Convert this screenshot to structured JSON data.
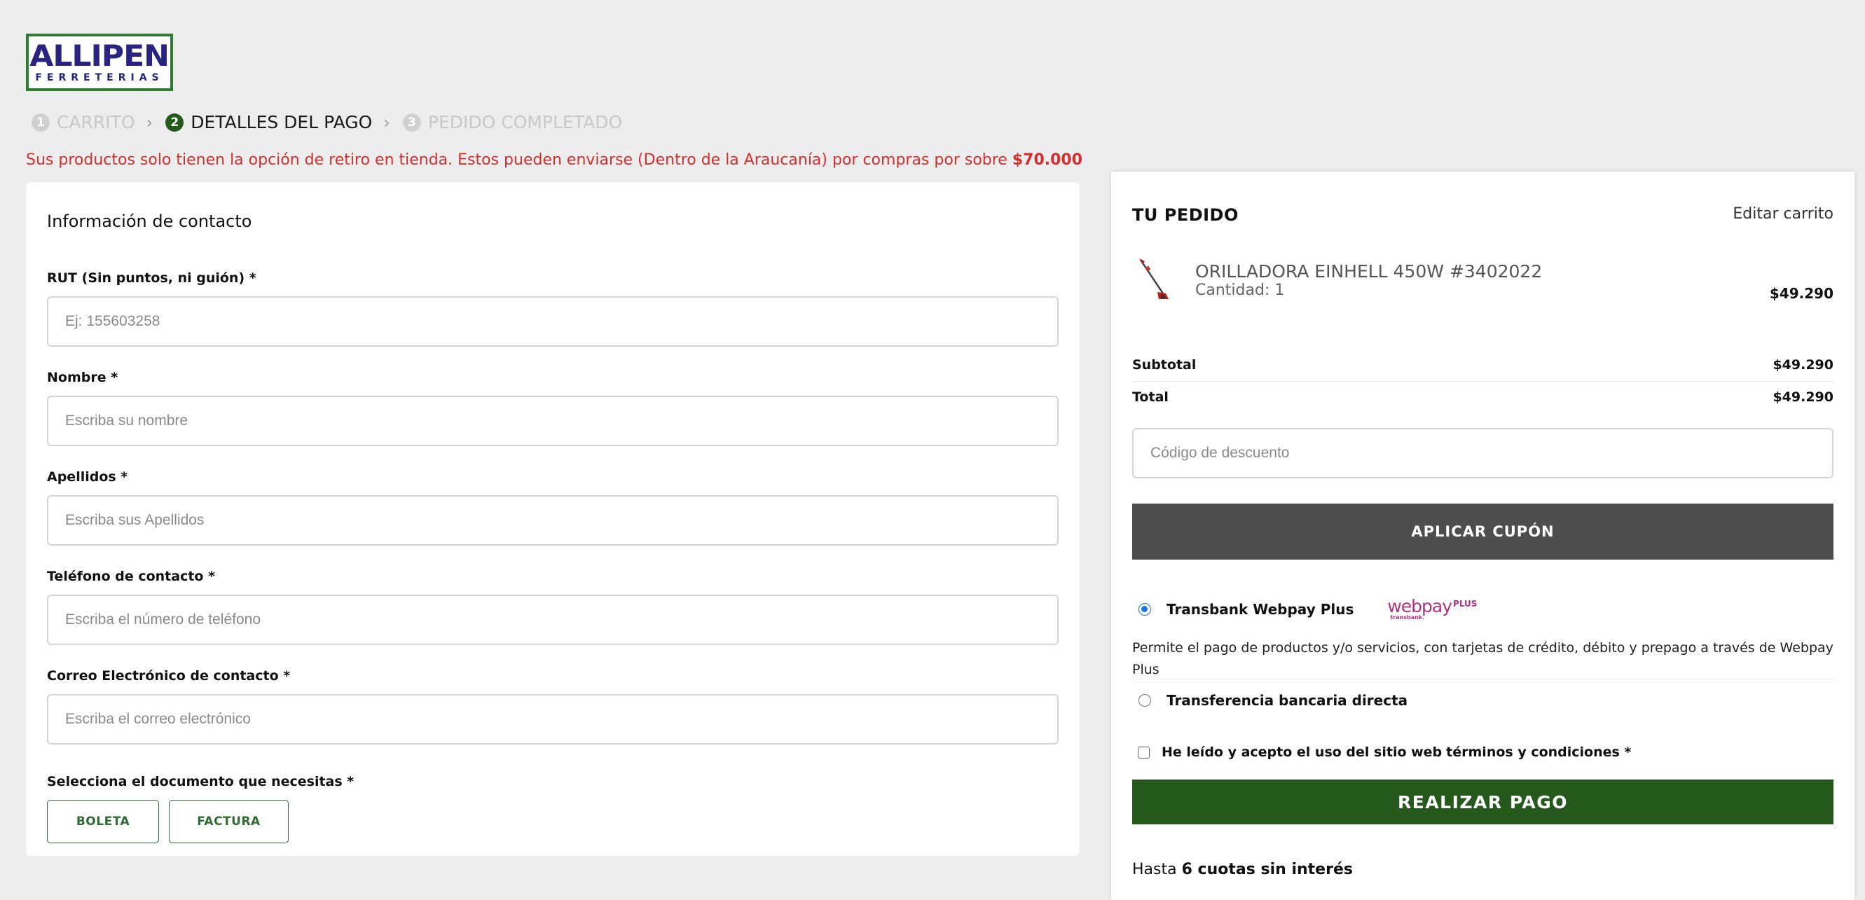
{
  "header": {
    "logo_text": "ALLIPEN",
    "logo_subtext": "FERRETERIAS",
    "steps": [
      {
        "num": "1",
        "label": "CARRITO",
        "state": "inactive"
      },
      {
        "num": "2",
        "label": "DETALLES DEL PAGO",
        "state": "active"
      },
      {
        "num": "3",
        "label": "PEDIDO COMPLETADO",
        "state": "inactive"
      }
    ],
    "chevron": "›"
  },
  "notice": {
    "text": "Sus productos solo tienen la opción de retiro en tienda. Estos pueden enviarse (Dentro de la Araucanía) por compras por sobre ",
    "amount": "$70.000",
    "color": "#d32f2f"
  },
  "contact_form": {
    "title": "Información de contacto",
    "fields": [
      {
        "label": "RUT (Sin puntos, ni guión) *",
        "placeholder": "Ej: 155603258",
        "value": ""
      },
      {
        "label": "Nombre *",
        "placeholder": "Escriba su nombre",
        "value": ""
      },
      {
        "label": "Apellidos *",
        "placeholder": "Escriba sus Apellidos",
        "value": ""
      },
      {
        "label": "Teléfono de contacto *",
        "placeholder": "Escriba el número de teléfono",
        "value": ""
      },
      {
        "label": "Correo Electrónico de contacto *",
        "placeholder": "Escriba el correo electrónico",
        "value": ""
      }
    ],
    "document_label": "Selecciona el documento que necesitas *",
    "document_options": [
      "BOLETA",
      "FACTURA"
    ]
  },
  "order": {
    "title": "TU PEDIDO",
    "edit_link": "Editar carrito",
    "product": {
      "name": "ORILLADORA EINHELL 450W #3402022",
      "quantity": "Cantidad: 1",
      "price": "$49.290",
      "image_icon": "trimmer-product-image"
    },
    "subtotal_label": "Subtotal",
    "subtotal_value": "$49.290",
    "total_label": "Total",
    "total_value": "$49.290",
    "coupon_placeholder": "Código de descuento",
    "coupon_button": "APLICAR CUPÓN",
    "payment_methods": [
      {
        "label": "Transbank Webpay Plus",
        "selected": true,
        "logo_text": "webpay",
        "logo_plus": "PLUS",
        "logo_sub": "transbank."
      },
      {
        "label": "Transferencia bancaria directa",
        "selected": false
      }
    ],
    "payment_description": "Permite el pago de productos y/o servicios, con tarjetas de crédito, débito y prepago a través de Webpay Plus",
    "terms_text": "He leído y acepto el uso del sitio web",
    "terms_link": "términos y condiciones *",
    "pay_button": "REALIZAR PAGO",
    "installments_prefix": "Hasta",
    "installments_value": "6 cuotas sin interés"
  },
  "colors": {
    "brand_green": "#255a1c",
    "brand_blue": "#2a2380",
    "coupon_button_bg": "#4e4e4e",
    "webpay_magenta": "#b0327f"
  }
}
